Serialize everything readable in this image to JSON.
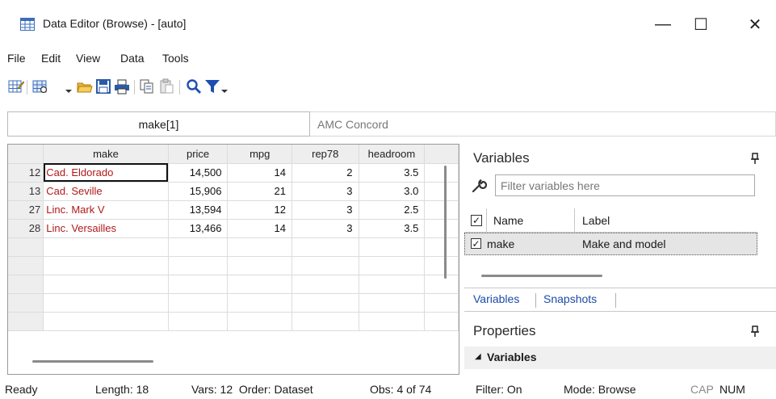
{
  "window": {
    "title": "Data Editor (Browse) - [auto]",
    "minimize_glyph": "—",
    "maximize_glyph": "☐",
    "close_glyph": "✕"
  },
  "menu": [
    "File",
    "Edit",
    "View",
    "Data",
    "Tools"
  ],
  "toolbar": {
    "icons": [
      "edit-mode-icon",
      "browse-mode-icon",
      "open-icon",
      "save-icon",
      "print-icon",
      "copy-icon",
      "paste-icon",
      "find-icon",
      "filter-icon"
    ]
  },
  "editbar": {
    "cell_ref": "make[1]",
    "cell_value": "AMC Concord"
  },
  "grid": {
    "columns": [
      "make",
      "price",
      "mpg",
      "rep78",
      "headroom"
    ],
    "rows": [
      {
        "num": "12",
        "make": "Cad. Eldorado",
        "price": "14,500",
        "mpg": "14",
        "rep78": "2",
        "headroom": "3.5"
      },
      {
        "num": "13",
        "make": "Cad. Seville",
        "price": "15,906",
        "mpg": "21",
        "rep78": "3",
        "headroom": "3.0"
      },
      {
        "num": "27",
        "make": "Linc. Mark V",
        "price": "13,594",
        "mpg": "12",
        "rep78": "3",
        "headroom": "2.5"
      },
      {
        "num": "28",
        "make": "Linc. Versailles",
        "price": "13,466",
        "mpg": "14",
        "rep78": "3",
        "headroom": "3.5"
      }
    ],
    "empty_rows": 5
  },
  "variables_panel": {
    "title": "Variables",
    "pin_glyph": "⊥",
    "filter_placeholder": "Filter variables here",
    "col_name": "Name",
    "col_label": "Label",
    "check_glyph": "✓",
    "var_name": "make",
    "var_label": "Make and model",
    "tabs": [
      "Variables",
      "Snapshots"
    ]
  },
  "properties_panel": {
    "title": "Properties",
    "section": "Variables",
    "section_arrow": "◢"
  },
  "status": {
    "ready": "Ready",
    "length": "Length: 18",
    "vars_order": "Vars: 12  Order: Dataset",
    "obs": "Obs: 4 of 74",
    "filter": "Filter: On",
    "mode": "Mode: Browse",
    "cap": "CAP",
    "num": "NUM"
  },
  "colors": {
    "string_text": "#b01919",
    "link_blue": "#1b4ba8",
    "funnel_blue": "#1d4fb2"
  }
}
